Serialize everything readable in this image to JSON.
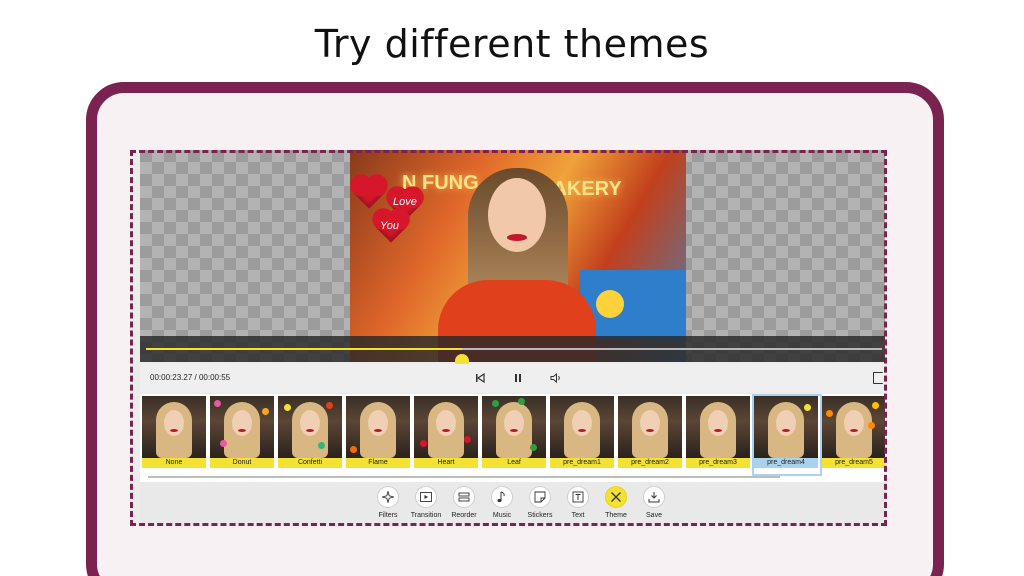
{
  "headline": "Try different themes",
  "photo_signs": {
    "left": "N FUNG",
    "right": "BAKERY"
  },
  "hearts": [
    {
      "text": ""
    },
    {
      "text": "Love"
    },
    {
      "text": "You"
    }
  ],
  "player": {
    "current_time": "00:00:23.27",
    "separator": "/",
    "total_time": "00:00:55",
    "progress": 0.43
  },
  "themes": [
    {
      "label": "None",
      "selected": false
    },
    {
      "label": "Donut",
      "selected": false
    },
    {
      "label": "Confetti",
      "selected": false
    },
    {
      "label": "Flame",
      "selected": false
    },
    {
      "label": "Heart",
      "selected": false
    },
    {
      "label": "Leaf",
      "selected": false
    },
    {
      "label": "pre_dream1",
      "selected": false
    },
    {
      "label": "pre_dream2",
      "selected": false
    },
    {
      "label": "pre_dream3",
      "selected": false
    },
    {
      "label": "pre_dream4",
      "selected": true
    },
    {
      "label": "pre_dream5",
      "selected": false
    }
  ],
  "toolbar": {
    "filters": "Filters",
    "transition": "Transition",
    "reorder": "Reorder",
    "music": "Music",
    "stickers": "Stickers",
    "text": "Text",
    "theme": "Theme",
    "save": "Save",
    "active": "theme"
  },
  "colors": {
    "frame": "#7a2350",
    "accent": "#f3e233",
    "selected": "#a9d2ee"
  }
}
